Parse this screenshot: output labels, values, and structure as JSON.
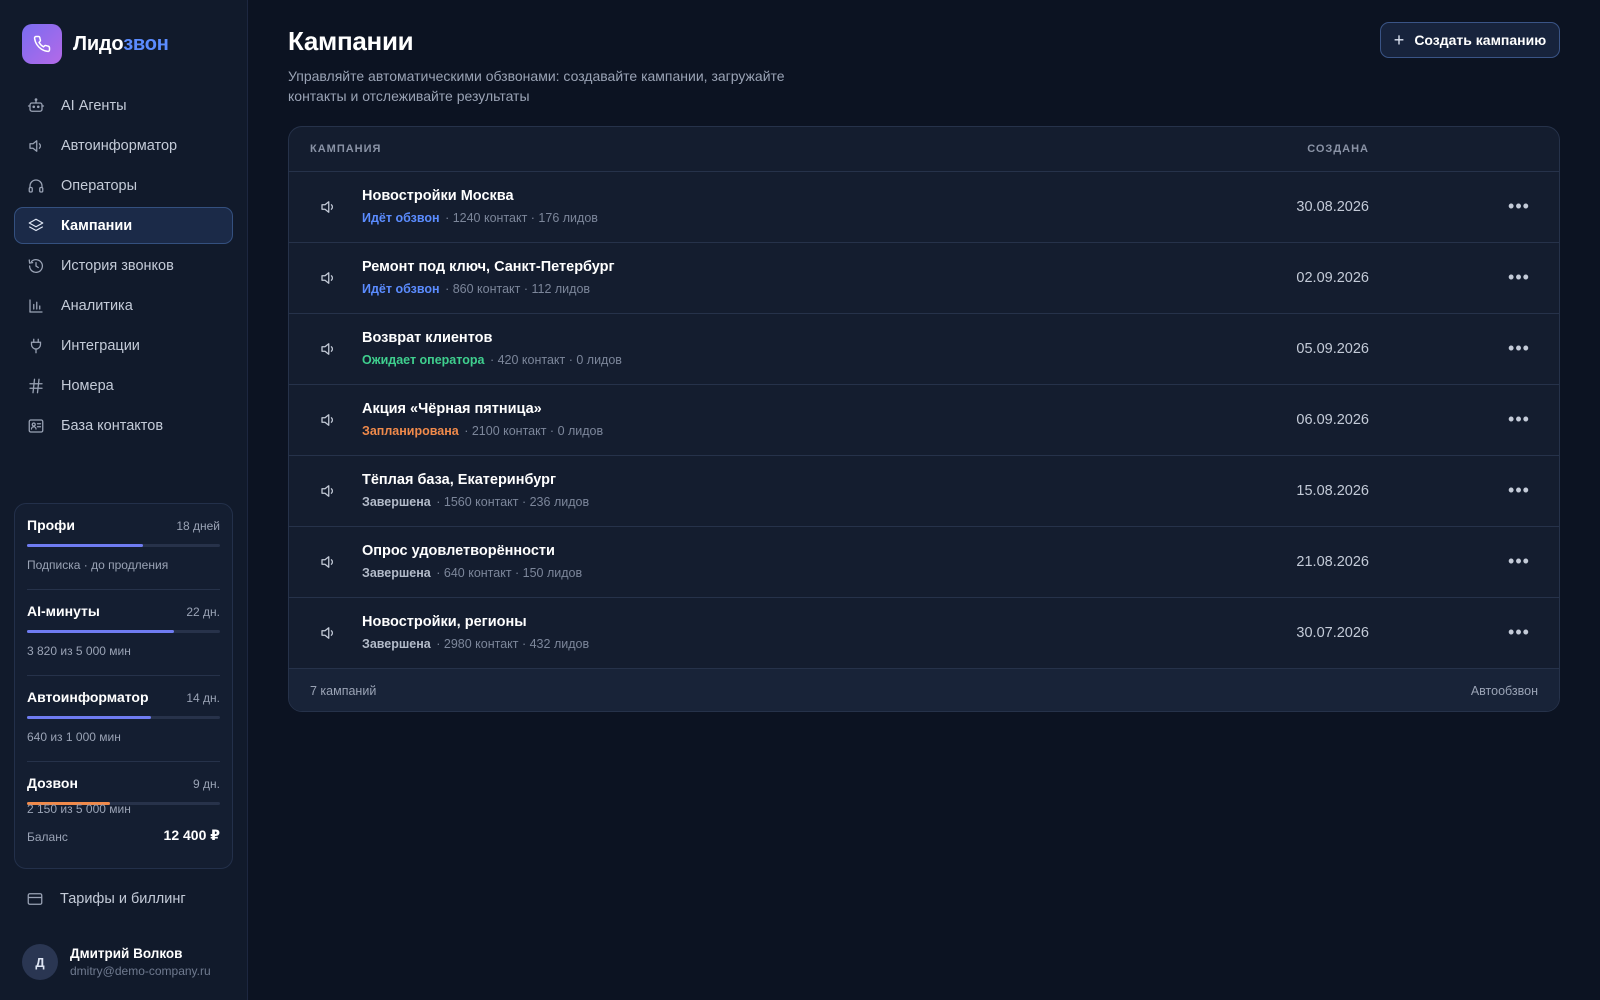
{
  "brand": {
    "name_part1": "Лидо",
    "name_part2": "звон"
  },
  "sidebar": {
    "items": [
      {
        "label": "AI Агенты",
        "icon": "robot-icon"
      },
      {
        "label": "Автоинформатор",
        "icon": "speaker-icon"
      },
      {
        "label": "Операторы",
        "icon": "headset-icon"
      },
      {
        "label": "Кампании",
        "icon": "layers-icon",
        "active": true
      },
      {
        "label": "История звонков",
        "icon": "history-icon"
      },
      {
        "label": "Аналитика",
        "icon": "bar-chart-icon"
      },
      {
        "label": "Интеграции",
        "icon": "plug-icon"
      },
      {
        "label": "Номера",
        "icon": "hash-icon"
      },
      {
        "label": "База контактов",
        "icon": "contact-card-icon"
      }
    ],
    "billing_label": "Тарифы и биллинг"
  },
  "usage": {
    "blocks": [
      {
        "name": "Профи",
        "days": "18 дней",
        "sub": "Подписка · до продления",
        "progress": 0.6,
        "color": "#6f7cf2"
      },
      {
        "name": "AI-минуты",
        "days": "22 дн.",
        "sub": "3 820 из 5 000 мин",
        "progress": 0.764,
        "color": "#6f7cf2"
      },
      {
        "name": "Автоинформатор",
        "days": "14 дн.",
        "sub": "640 из 1 000 мин",
        "progress": 0.64,
        "color": "#6f7cf2"
      },
      {
        "name": "Дозвон",
        "days": "9 дн.",
        "sub": "2 150 из 5 000 мин",
        "progress": 0.43,
        "color": "#f08a4b"
      }
    ],
    "balance_label": "Баланс",
    "balance_value": "12 400 ₽"
  },
  "user": {
    "initial": "Д",
    "name": "Дмитрий Волков",
    "email": "dmitry@demo-company.ru"
  },
  "header": {
    "title": "Кампании",
    "subtitle": "Управляйте автоматическими обзвонами: создавайте кампании, загружайте контакты и отслеживайте результаты",
    "create_button": "Создать кампанию"
  },
  "table": {
    "col_campaign": "КАМПАНИЯ",
    "col_created": "СОЗДАНА",
    "rows": [
      {
        "name": "Новостройки Москва",
        "status": "Идёт обзвон",
        "status_color": "#5b8cff",
        "stats": "· 1240 контакт · 176 лидов",
        "date": "30.08.2026"
      },
      {
        "name": "Ремонт под ключ, Санкт-Петербург",
        "status": "Идёт обзвон",
        "status_color": "#5b8cff",
        "stats": "· 860 контакт · 112 лидов",
        "date": "02.09.2026"
      },
      {
        "name": "Возврат клиентов",
        "status": "Ожидает оператора",
        "status_color": "#3fcf8e",
        "stats": "· 420 контакт · 0 лидов",
        "date": "05.09.2026"
      },
      {
        "name": "Акция «Чёрная пятница»",
        "status": "Запланирована",
        "status_color": "#f08a4b",
        "stats": "· 2100 контакт · 0 лидов",
        "date": "06.09.2026"
      },
      {
        "name": "Тёплая база, Екатеринбург",
        "status": "Завершена",
        "status_color": "#b3bbc9",
        "stats": "· 1560 контакт · 236 лидов",
        "date": "15.08.2026"
      },
      {
        "name": "Опрос удовлетворённости",
        "status": "Завершена",
        "status_color": "#b3bbc9",
        "stats": "· 640 контакт · 150 лидов",
        "date": "21.08.2026"
      },
      {
        "name": "Новостройки, регионы",
        "status": "Завершена",
        "status_color": "#b3bbc9",
        "stats": "· 2980 контакт · 432 лидов",
        "date": "30.07.2026"
      }
    ],
    "footer_count": "7 кампаний",
    "footer_type": "Автообзвон"
  }
}
